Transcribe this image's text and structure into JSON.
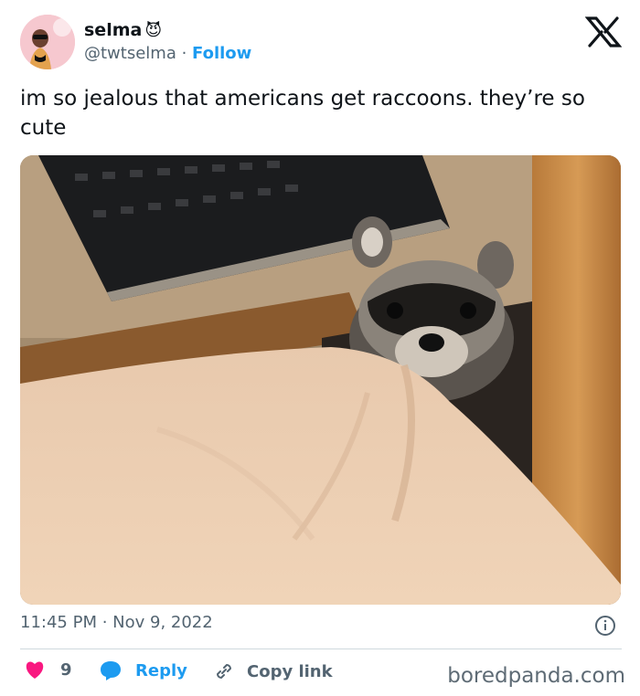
{
  "tweet": {
    "display_name": "selma",
    "name_emoji": "😈",
    "handle": "@twtselma",
    "separator": " · ",
    "follow_label": "Follow",
    "text": "im so jealous that americans get raccoons. they’re so cute",
    "timestamp": "11:45 PM · Nov 9, 2022"
  },
  "actions": {
    "like_count": "9",
    "reply_label": "Reply",
    "copy_link_label": "Copy link"
  },
  "watermark": "boredpanda.com",
  "colors": {
    "accent": "#1d9bf0",
    "heart": "#f91880",
    "secondary_text": "#536471"
  },
  "icons": [
    "x-logo-icon",
    "info-icon",
    "heart-icon",
    "reply-bubble-icon",
    "link-icon"
  ]
}
